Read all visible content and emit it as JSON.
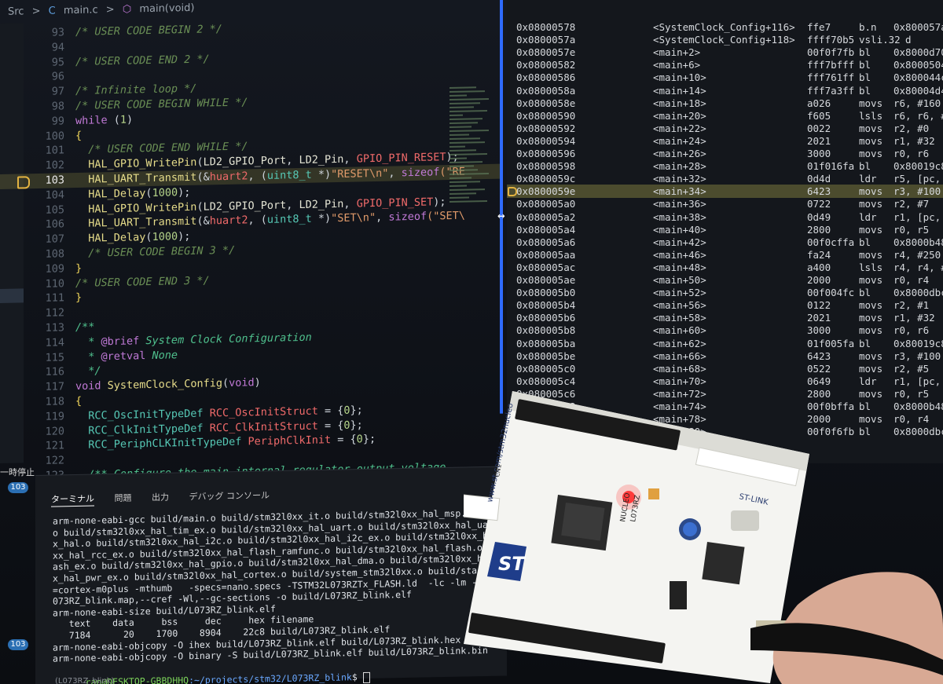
{
  "breadcrumb": {
    "folder": "Src",
    "sep1": ">",
    "lang_icon": "C",
    "file": "main.c",
    "sep2": ">",
    "function": "main(void)"
  },
  "editor": {
    "current_line": "103",
    "lines": [
      {
        "n": "93",
        "segs": [
          {
            "t": "/* USER CODE BEGIN 2 */",
            "c": "com"
          }
        ]
      },
      {
        "n": "94",
        "segs": []
      },
      {
        "n": "95",
        "segs": [
          {
            "t": "/* USER CODE END 2 */",
            "c": "com"
          }
        ]
      },
      {
        "n": "96",
        "segs": []
      },
      {
        "n": "97",
        "segs": [
          {
            "t": "/* Infinite loop */",
            "c": "com"
          }
        ]
      },
      {
        "n": "98",
        "segs": [
          {
            "t": "/* USER CODE BEGIN WHILE */",
            "c": "com"
          }
        ]
      },
      {
        "n": "99",
        "segs": [
          {
            "t": "while",
            "c": "kw"
          },
          {
            "t": " (",
            "c": "plain"
          },
          {
            "t": "1",
            "c": "num"
          },
          {
            "t": ")",
            "c": "plain"
          }
        ]
      },
      {
        "n": "100",
        "segs": [
          {
            "t": "{",
            "c": "brace"
          }
        ]
      },
      {
        "n": "101",
        "segs": [
          {
            "t": "  /* USER CODE END WHILE */",
            "c": "com"
          }
        ]
      },
      {
        "n": "102",
        "segs": [
          {
            "t": "  ",
            "c": "plain"
          },
          {
            "t": "HAL_GPIO_WritePin",
            "c": "fn"
          },
          {
            "t": "(",
            "c": "plain"
          },
          {
            "t": "LD2_GPIO_Port",
            "c": "id"
          },
          {
            "t": ", ",
            "c": "plain"
          },
          {
            "t": "LD2_Pin",
            "c": "id"
          },
          {
            "t": ", ",
            "c": "plain"
          },
          {
            "t": "GPIO_PIN_RESET",
            "c": "red"
          },
          {
            "t": ");",
            "c": "plain"
          }
        ]
      },
      {
        "n": "103",
        "segs": [
          {
            "t": "  ",
            "c": "plain"
          },
          {
            "t": "HAL_UART_Transmit",
            "c": "fn"
          },
          {
            "t": "(&",
            "c": "plain"
          },
          {
            "t": "huart2",
            "c": "red"
          },
          {
            "t": ", (",
            "c": "plain"
          },
          {
            "t": "uint8_t",
            "c": "ty"
          },
          {
            "t": " *)",
            "c": "plain"
          },
          {
            "t": "\"RESET\\n\"",
            "c": "str"
          },
          {
            "t": ", ",
            "c": "plain"
          },
          {
            "t": "sizeof",
            "c": "kw"
          },
          {
            "t": "(\"RE",
            "c": "str"
          }
        ]
      },
      {
        "n": "104",
        "segs": [
          {
            "t": "  ",
            "c": "plain"
          },
          {
            "t": "HAL_Delay",
            "c": "fn"
          },
          {
            "t": "(",
            "c": "plain"
          },
          {
            "t": "1000",
            "c": "num"
          },
          {
            "t": ");",
            "c": "plain"
          }
        ]
      },
      {
        "n": "105",
        "segs": [
          {
            "t": "  ",
            "c": "plain"
          },
          {
            "t": "HAL_GPIO_WritePin",
            "c": "fn"
          },
          {
            "t": "(",
            "c": "plain"
          },
          {
            "t": "LD2_GPIO_Port",
            "c": "id"
          },
          {
            "t": ", ",
            "c": "plain"
          },
          {
            "t": "LD2_Pin",
            "c": "id"
          },
          {
            "t": ", ",
            "c": "plain"
          },
          {
            "t": "GPIO_PIN_SET",
            "c": "red"
          },
          {
            "t": ");",
            "c": "plain"
          }
        ]
      },
      {
        "n": "106",
        "segs": [
          {
            "t": "  ",
            "c": "plain"
          },
          {
            "t": "HAL_UART_Transmit",
            "c": "fn"
          },
          {
            "t": "(&",
            "c": "plain"
          },
          {
            "t": "huart2",
            "c": "red"
          },
          {
            "t": ", (",
            "c": "plain"
          },
          {
            "t": "uint8_t",
            "c": "ty"
          },
          {
            "t": " *)",
            "c": "plain"
          },
          {
            "t": "\"SET\\n\"",
            "c": "str"
          },
          {
            "t": ", ",
            "c": "plain"
          },
          {
            "t": "sizeof",
            "c": "kw"
          },
          {
            "t": "(\"SET\\",
            "c": "str"
          }
        ]
      },
      {
        "n": "107",
        "segs": [
          {
            "t": "  ",
            "c": "plain"
          },
          {
            "t": "HAL_Delay",
            "c": "fn"
          },
          {
            "t": "(",
            "c": "plain"
          },
          {
            "t": "1000",
            "c": "num"
          },
          {
            "t": ");",
            "c": "plain"
          }
        ]
      },
      {
        "n": "108",
        "segs": [
          {
            "t": "  /* USER CODE BEGIN 3 */",
            "c": "com"
          }
        ]
      },
      {
        "n": "109",
        "segs": [
          {
            "t": "}",
            "c": "brace"
          }
        ]
      },
      {
        "n": "110",
        "segs": [
          {
            "t": "/* USER CODE END 3 */",
            "c": "com"
          }
        ]
      },
      {
        "n": "111",
        "segs": [
          {
            "t": "}",
            "c": "brace"
          }
        ]
      },
      {
        "n": "112",
        "segs": []
      },
      {
        "n": "113",
        "segs": [
          {
            "t": "/**",
            "c": "doc"
          }
        ]
      },
      {
        "n": "114",
        "segs": [
          {
            "t": "  * ",
            "c": "doc"
          },
          {
            "t": "@brief",
            "c": "kw"
          },
          {
            "t": " System Clock Configuration",
            "c": "doc"
          }
        ]
      },
      {
        "n": "115",
        "segs": [
          {
            "t": "  * ",
            "c": "doc"
          },
          {
            "t": "@retval",
            "c": "kw"
          },
          {
            "t": " None",
            "c": "doc"
          }
        ]
      },
      {
        "n": "116",
        "segs": [
          {
            "t": "  */",
            "c": "doc"
          }
        ]
      },
      {
        "n": "117",
        "segs": [
          {
            "t": "void",
            "c": "kw"
          },
          {
            "t": " ",
            "c": "plain"
          },
          {
            "t": "SystemClock_Config",
            "c": "fn"
          },
          {
            "t": "(",
            "c": "plain"
          },
          {
            "t": "void",
            "c": "kw"
          },
          {
            "t": ")",
            "c": "plain"
          }
        ]
      },
      {
        "n": "118",
        "segs": [
          {
            "t": "{",
            "c": "brace"
          }
        ]
      },
      {
        "n": "119",
        "segs": [
          {
            "t": "  ",
            "c": "plain"
          },
          {
            "t": "RCC_OscInitTypeDef",
            "c": "ty"
          },
          {
            "t": " ",
            "c": "plain"
          },
          {
            "t": "RCC_OscInitStruct",
            "c": "red"
          },
          {
            "t": " = {",
            "c": "plain"
          },
          {
            "t": "0",
            "c": "num"
          },
          {
            "t": "};",
            "c": "plain"
          }
        ]
      },
      {
        "n": "120",
        "segs": [
          {
            "t": "  ",
            "c": "plain"
          },
          {
            "t": "RCC_ClkInitTypeDef",
            "c": "ty"
          },
          {
            "t": " ",
            "c": "plain"
          },
          {
            "t": "RCC_ClkInitStruct",
            "c": "red"
          },
          {
            "t": " = {",
            "c": "plain"
          },
          {
            "t": "0",
            "c": "num"
          },
          {
            "t": "};",
            "c": "plain"
          }
        ]
      },
      {
        "n": "121",
        "segs": [
          {
            "t": "  ",
            "c": "plain"
          },
          {
            "t": "RCC_PeriphCLKInitTypeDef",
            "c": "ty"
          },
          {
            "t": " ",
            "c": "plain"
          },
          {
            "t": "PeriphClkInit",
            "c": "red"
          },
          {
            "t": " = {",
            "c": "plain"
          },
          {
            "t": "0",
            "c": "num"
          },
          {
            "t": "};",
            "c": "plain"
          }
        ]
      },
      {
        "n": "122",
        "segs": []
      },
      {
        "n": "123",
        "segs": [
          {
            "t": "  /** Configure the main internal regulator output voltage",
            "c": "doc"
          }
        ]
      },
      {
        "n": "124",
        "segs": [
          {
            "t": "  */",
            "c": "doc"
          }
        ]
      }
    ]
  },
  "side": {
    "pause_label": "一時停止",
    "badge_top": "103",
    "badge_bottom": "103"
  },
  "terminal": {
    "tabs": [
      "ターミナル",
      "問題",
      "出力",
      "デバッグ コンソール"
    ],
    "lines": [
      "arm-none-eabi-gcc build/main.o build/stm32l0xx_it.o build/stm32l0xx_hal_msp.o build/stm32",
      "o build/stm32l0xx_hal_tim_ex.o build/stm32l0xx_hal_uart.o build/stm32l0xx_hal_uart_ex.o",
      "x_hal.o build/stm32l0xx_hal_i2c.o build/stm32l0xx_hal_i2c_ex.o build/stm32l0xx_hal_rcc.o",
      "xx_hal_rcc_ex.o build/stm32l0xx_hal_flash_ramfunc.o build/stm32l0xx_hal_flash.o build/s",
      "ash_ex.o build/stm32l0xx_hal_gpio.o build/stm32l0xx_hal_dma.o build/stm32l0xx_hal_pwr.o",
      "x_hal_pwr_ex.o build/stm32l0xx_hal_cortex.o build/system_stm32l0xx.o build/startup_stm",
      "=cortex-m0plus -mthumb   -specs=nano.specs -TSTM32L073RZTx_FLASH.ld  -lc -lm -lnosys",
      "073RZ_blink.map,--cref -Wl,--gc-sections -o build/L073RZ_blink.elf",
      "arm-none-eabi-size build/L073RZ_blink.elf",
      "   text    data     bss     dec     hex filename",
      "   7184      20    1700    8904    22c8 build/L073RZ_blink.elf",
      "arm-none-eabi-objcopy -O ihex build/L073RZ_blink.elf build/L073RZ_blink.hex",
      "arm-none-eabi-objcopy -O binary -S build/L073RZ_blink.elf build/L073RZ_blink.bin"
    ],
    "prompt_user": "ran@DESKTOP-GBBDHHQ",
    "prompt_path": ":~/projects/stm32/L073RZ_blink",
    "prompt_symbol": "$ "
  },
  "disasm": {
    "current_addr": "0x0800059e",
    "rows": [
      {
        "addr": "0x08000578",
        "sym": "<SystemClock_Config+116>",
        "hex": "ffe7",
        "mn": "b.n",
        "op": "0x800057a"
      },
      {
        "addr": "0x0800057a",
        "sym": "<SystemClock_Config+118>",
        "hex": "ffff70b5",
        "mn": "vsli.32",
        "op": "  d"
      },
      {
        "addr": "0x0800057e",
        "sym": "<main+2>",
        "hex": "00f0f7fb",
        "mn": "bl",
        "op": "0x8000d70"
      },
      {
        "addr": "0x08000582",
        "sym": "<main+6>",
        "hex": "fff7bfff",
        "mn": "bl",
        "op": "0x8000504"
      },
      {
        "addr": "0x08000586",
        "sym": "<main+10>",
        "hex": "fff761ff",
        "mn": "bl",
        "op": "0x800044c"
      },
      {
        "addr": "0x0800058a",
        "sym": "<main+14>",
        "hex": "fff7a3ff",
        "mn": "bl",
        "op": "0x80004d4"
      },
      {
        "addr": "0x0800058e",
        "sym": "<main+18>",
        "hex": "a026",
        "mn": "movs",
        "op": "r6, #160"
      },
      {
        "addr": "0x08000590",
        "sym": "<main+20>",
        "hex": "f605",
        "mn": "lsls",
        "op": "r6, r6, #2"
      },
      {
        "addr": "0x08000592",
        "sym": "<main+22>",
        "hex": "0022",
        "mn": "movs",
        "op": "r2, #0"
      },
      {
        "addr": "0x08000594",
        "sym": "<main+24>",
        "hex": "2021",
        "mn": "movs",
        "op": "r1, #32"
      },
      {
        "addr": "0x08000596",
        "sym": "<main+26>",
        "hex": "3000",
        "mn": "movs",
        "op": "r0, r6"
      },
      {
        "addr": "0x08000598",
        "sym": "<main+28>",
        "hex": "01f016fa",
        "mn": "bl",
        "op": "0x80019c8 <"
      },
      {
        "addr": "0x0800059c",
        "sym": "<main+32>",
        "hex": "0d4d",
        "mn": "ldr",
        "op": "r5, [pc, #5"
      },
      {
        "addr": "0x0800059e",
        "sym": "<main+34>",
        "hex": "6423",
        "mn": "movs",
        "op": "r3, #100"
      },
      {
        "addr": "0x080005a0",
        "sym": "<main+36>",
        "hex": "0722",
        "mn": "movs",
        "op": "r2, #7"
      },
      {
        "addr": "0x080005a2",
        "sym": "<main+38>",
        "hex": "0d49",
        "mn": "ldr",
        "op": "r1, [pc, #5"
      },
      {
        "addr": "0x080005a4",
        "sym": "<main+40>",
        "hex": "2800",
        "mn": "movs",
        "op": "r0, r5"
      },
      {
        "addr": "0x080005a6",
        "sym": "<main+42>",
        "hex": "00f0cffa",
        "mn": "bl",
        "op": "0x8000b48 <"
      },
      {
        "addr": "0x080005aa",
        "sym": "<main+46>",
        "hex": "fa24",
        "mn": "movs",
        "op": "r4, #250"
      },
      {
        "addr": "0x080005ac",
        "sym": "<main+48>",
        "hex": "a400",
        "mn": "lsls",
        "op": "r4, r4, #2"
      },
      {
        "addr": "0x080005ae",
        "sym": "<main+50>",
        "hex": "2000",
        "mn": "movs",
        "op": "r0, r4"
      },
      {
        "addr": "0x080005b0",
        "sym": "<main+52>",
        "hex": "00f004fc",
        "mn": "bl",
        "op": "0x8000dbc <"
      },
      {
        "addr": "0x080005b4",
        "sym": "<main+56>",
        "hex": "0122",
        "mn": "movs",
        "op": "r2, #1"
      },
      {
        "addr": "0x080005b6",
        "sym": "<main+58>",
        "hex": "2021",
        "mn": "movs",
        "op": "r1, #32"
      },
      {
        "addr": "0x080005b8",
        "sym": "<main+60>",
        "hex": "3000",
        "mn": "movs",
        "op": "r0, r6"
      },
      {
        "addr": "0x080005ba",
        "sym": "<main+62>",
        "hex": "01f005fa",
        "mn": "bl",
        "op": "0x80019c8 <HA"
      },
      {
        "addr": "0x080005be",
        "sym": "<main+66>",
        "hex": "6423",
        "mn": "movs",
        "op": "r3, #100"
      },
      {
        "addr": "0x080005c0",
        "sym": "<main+68>",
        "hex": "0522",
        "mn": "movs",
        "op": "r2, #5"
      },
      {
        "addr": "0x080005c4",
        "sym": "<main+70>",
        "hex": "0649",
        "mn": "ldr",
        "op": "r1, [pc, #24]"
      },
      {
        "addr": "0x080005c6",
        "sym": "<main+72>",
        "hex": "2800",
        "mn": "movs",
        "op": "r0, r5"
      },
      {
        "addr": "0x080005c8",
        "sym": "<main+74>",
        "hex": "00f0bffa",
        "mn": "bl",
        "op": "0x8000b48 <HA"
      },
      {
        "addr": "0x080005cc",
        "sym": "<main+78>",
        "hex": "2000",
        "mn": "movs",
        "op": "r0, r4"
      },
      {
        "addr": "0x080005ce",
        "sym": "<main+80>",
        "hex": "00f0f6fb",
        "mn": "bl",
        "op": "0x8000dbc <HA"
      }
    ]
  },
  "board_labels": {
    "brand": "www.st.com/stm32nucleo",
    "model": "NUCLEO",
    "part": "L073RZ",
    "debugger": "ST-LINK",
    "cn": "CN1"
  },
  "status": {
    "text": "(L073RZ_blink)"
  },
  "colors": {
    "highlight": "#d2c85a",
    "accent": "#2f6bff",
    "board_pcb": "#f4f4f1",
    "led_red": "#ff3b3b"
  },
  "icons": {
    "resize": "↔",
    "paused_line": "debug-arrow-icon"
  }
}
